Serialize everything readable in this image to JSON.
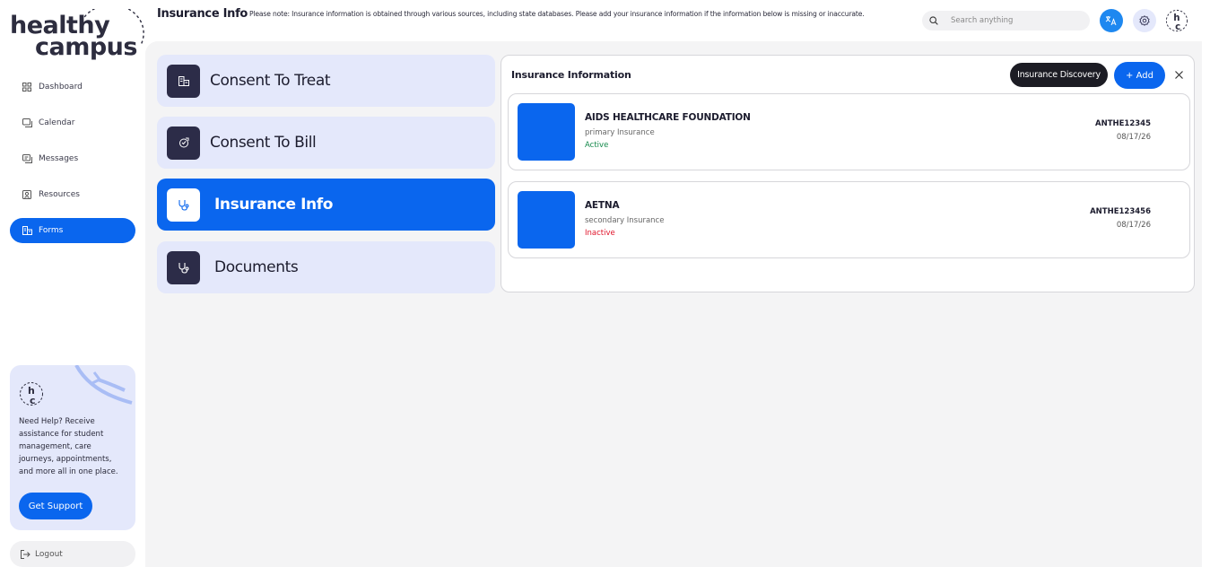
{
  "brand": {
    "line1": "healthy",
    "line2": "campus",
    "avatar_initials": "hc"
  },
  "sidebar": {
    "items": [
      {
        "label": "Dashboard",
        "icon": "grid-icon",
        "active": false
      },
      {
        "label": "Calendar",
        "icon": "calendar-icon",
        "active": false
      },
      {
        "label": "Messages",
        "icon": "chat-icon",
        "active": false
      },
      {
        "label": "Resources",
        "icon": "book-icon",
        "active": false
      },
      {
        "label": "Forms",
        "icon": "building-icon",
        "active": true
      }
    ],
    "help": {
      "text": "Need Help? Receive assistance for student management, care journeys, appointments, and more all in one place.",
      "button": "Get Support"
    },
    "logout": "Logout"
  },
  "header": {
    "title": "Insurance Info",
    "notice": "Please note: Insurance information is obtained through various sources, including state databases. Please add your insurance information if the information below is missing or inaccurate.",
    "search_placeholder": "Search anything"
  },
  "forms": [
    {
      "label": "Consent To Treat",
      "icon": "building-icon",
      "active": false
    },
    {
      "label": "Consent To Bill",
      "icon": "bill-icon",
      "active": false
    },
    {
      "label": "Insurance Info",
      "icon": "stethoscope-icon",
      "active": true
    },
    {
      "label": "Documents",
      "icon": "stethoscope-icon",
      "active": false
    }
  ],
  "insurance_panel": {
    "title": "Insurance Information",
    "discovery_button": "Insurance Discovery",
    "add_button": "+ Add",
    "cards": [
      {
        "name": "AIDS HEALTHCARE FOUNDATION",
        "type": "primary Insurance",
        "status": "Active",
        "member_id": "ANTHE12345",
        "date": "08/17/26"
      },
      {
        "name": "AETNA",
        "type": "secondary Insurance",
        "status": "Inactive",
        "member_id": "ANTHE123456",
        "date": "08/17/26"
      }
    ]
  },
  "colors": {
    "accent": "#0a66ee",
    "dark": "#1c1c24",
    "soft": "#e4e8fb",
    "active": "#14894b",
    "inactive": "#e0142a"
  }
}
